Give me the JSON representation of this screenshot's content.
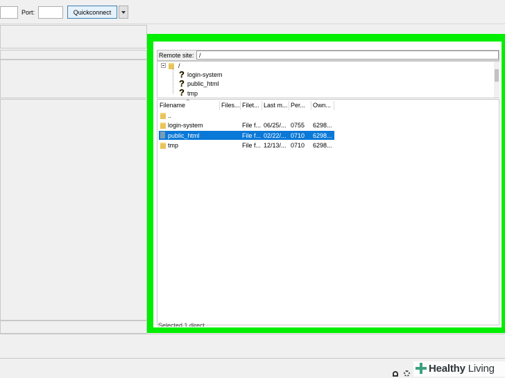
{
  "toolbar": {
    "port_label": "Port:",
    "quickconnect_label": "Quickconnect"
  },
  "remote": {
    "site_label": "Remote site:",
    "path_value": "/"
  },
  "tree": {
    "root": "/",
    "children": [
      "login-system",
      "public_html",
      "tmp"
    ]
  },
  "list": {
    "columns": [
      "Filename",
      "Files...",
      "Filet...",
      "Last m...",
      "Per...",
      "Own..."
    ],
    "rows": [
      {
        "name": "..",
        "size": "",
        "type": "",
        "modified": "",
        "perm": "",
        "owner": ""
      },
      {
        "name": "login-system",
        "size": "",
        "type": "File f...",
        "modified": "06/25/...",
        "perm": "0755",
        "owner": "6298..."
      },
      {
        "name": "public_html",
        "size": "",
        "type": "File f...",
        "modified": "02/22/...",
        "perm": "0710",
        "owner": "6298..."
      },
      {
        "name": "tmp",
        "size": "",
        "type": "File f...",
        "modified": "12/13/...",
        "perm": "0710",
        "owner": "6298..."
      }
    ],
    "selected_index": 2
  },
  "status": {
    "selected_text": "Selected 1 direct"
  },
  "watermark": {
    "brand_main": "Healthy",
    "brand_second": "Living"
  },
  "colors": {
    "highlight": "#00ee00",
    "selection": "#0a78d7",
    "button_border": "#3c7fb1"
  },
  "icons": {
    "tree_folder": "question-mark-folder-icon",
    "row_folder": "folder-icon",
    "selected_row": "server-folder-icon"
  }
}
